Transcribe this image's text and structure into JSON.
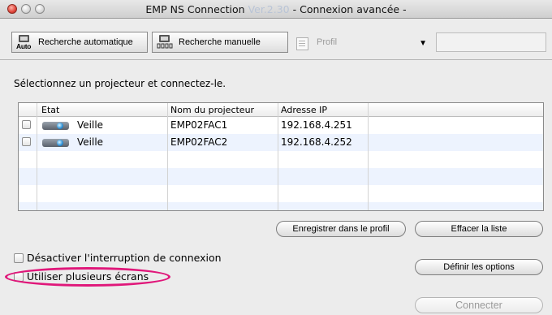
{
  "window": {
    "title_main": "EMP NS Connection ",
    "title_version": "Ver.2.30",
    "title_suffix": "  - Connexion avancée -"
  },
  "toolbar": {
    "auto_label": "Recherche automatique",
    "auto_icon_caption": "Auto",
    "manual_label": "Recherche manuelle",
    "profile_label": "Profil",
    "profile_field_value": ""
  },
  "instruction": "Sélectionnez un projecteur et connectez-le.",
  "table": {
    "headers": [
      "Etat",
      "Nom du projecteur",
      "Adresse IP"
    ],
    "rows": [
      {
        "status": "Veille",
        "name": "EMP02FAC1",
        "ip": "192.168.4.251"
      },
      {
        "status": "Veille",
        "name": "EMP02FAC2",
        "ip": "192.168.4.252"
      }
    ]
  },
  "buttons": {
    "save_profile": "Enregistrer dans le profil",
    "clear_list": "Effacer la liste",
    "set_options": "Définir les options",
    "connect": "Connecter"
  },
  "options": {
    "disable_interrupt": "Désactiver l'interruption de connexion",
    "multi_screens": "Utiliser plusieurs écrans"
  },
  "colors": {
    "highlight": "#e0177a",
    "row_alt": "#edf3fe"
  }
}
